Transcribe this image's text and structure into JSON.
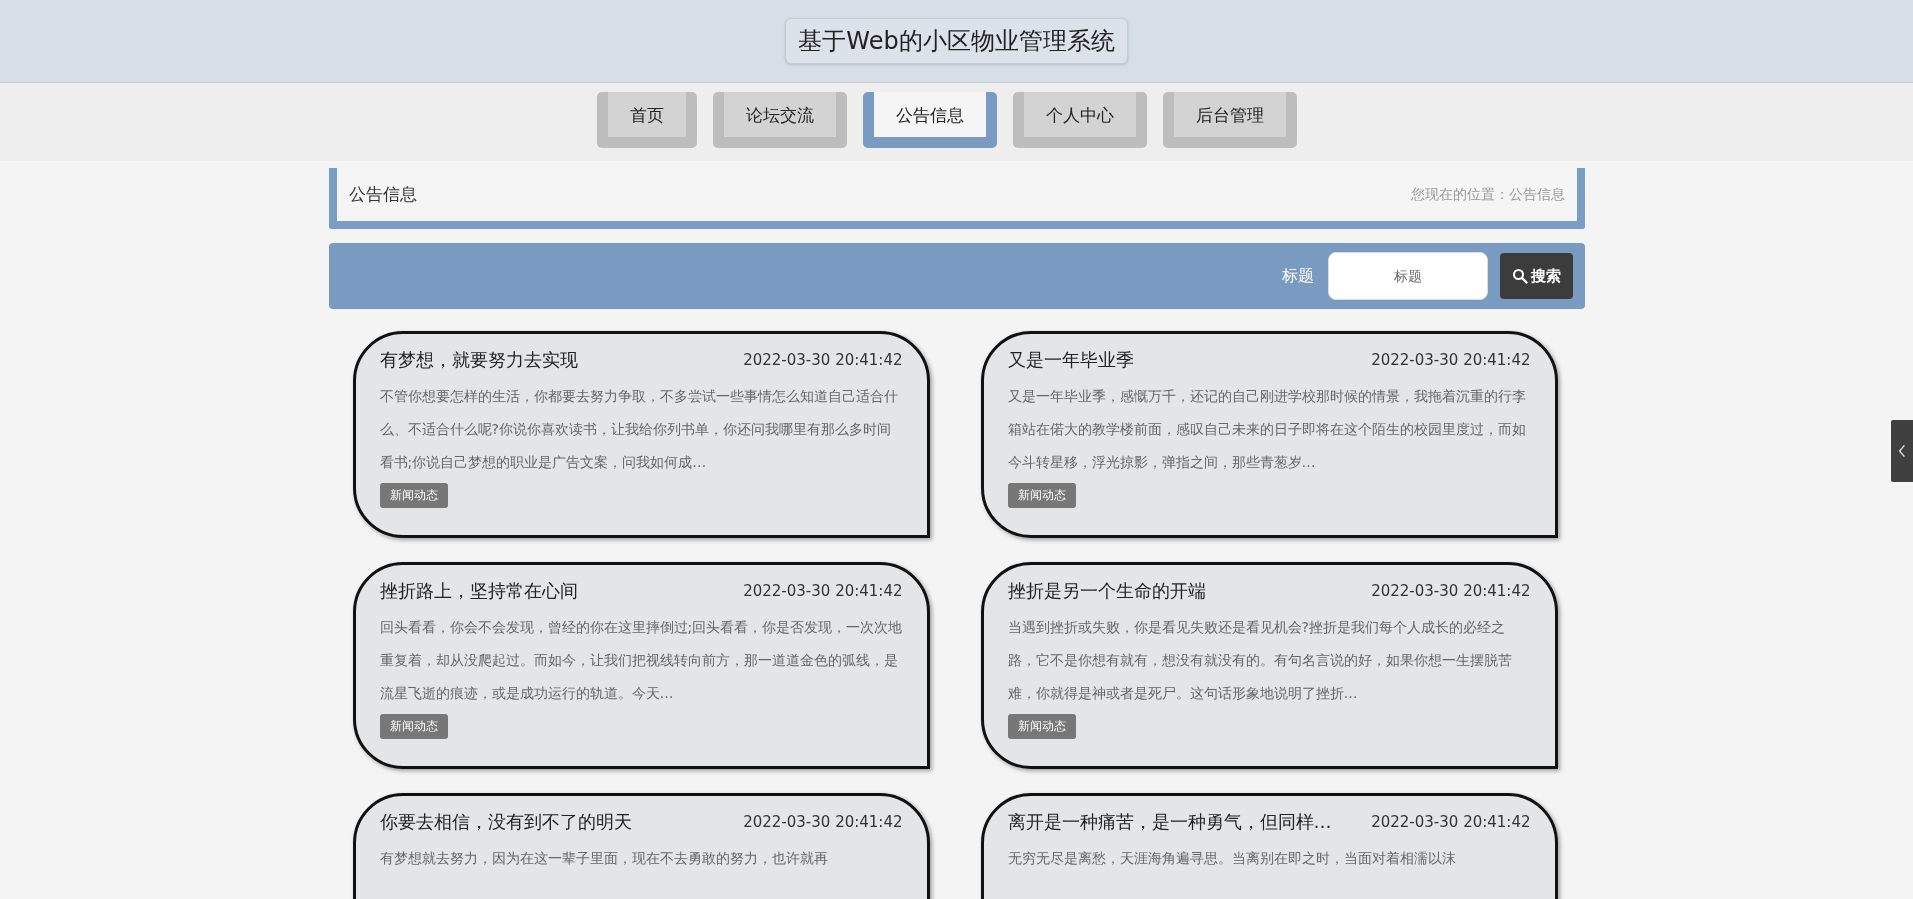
{
  "header": {
    "title": "基于Web的小区物业管理系统"
  },
  "nav": [
    {
      "label": "首页",
      "selected": false
    },
    {
      "label": "论坛交流",
      "selected": false
    },
    {
      "label": "公告信息",
      "selected": true
    },
    {
      "label": "个人中心",
      "selected": false
    },
    {
      "label": "后台管理",
      "selected": false
    }
  ],
  "breadcrumb": {
    "heading": "公告信息",
    "location": "您现在的位置：公告信息"
  },
  "search": {
    "label": "标题",
    "placeholder": "标题",
    "button": "搜索"
  },
  "notices": [
    {
      "title": "有梦想，就要努力去实现",
      "date": "2022-03-30 20:41:42",
      "summary": "不管你想要怎样的生活，你都要去努力争取，不多尝试一些事情怎么知道自己适合什么、不适合什么呢?你说你喜欢读书，让我给你列书单，你还问我哪里有那么多时间看书;你说自己梦想的职业是广告文案，问我如何成…",
      "tag": "新闻动态"
    },
    {
      "title": "又是一年毕业季",
      "date": "2022-03-30 20:41:42",
      "summary": "又是一年毕业季，感慨万千，还记的自己刚进学校那时候的情景，我拖着沉重的行李箱站在偌大的教学楼前面，感叹自己未来的日子即将在这个陌生的校园里度过，而如今斗转星移，浮光掠影，弹指之间，那些青葱岁…",
      "tag": "新闻动态"
    },
    {
      "title": "挫折路上，坚持常在心间",
      "date": "2022-03-30 20:41:42",
      "summary": "回头看看，你会不会发现，曾经的你在这里摔倒过;回头看看，你是否发现，一次次地重复着，却从没爬起过。而如今，让我们把视线转向前方，那一道道金色的弧线，是流星飞逝的痕迹，或是成功运行的轨道。今天…",
      "tag": "新闻动态"
    },
    {
      "title": "挫折是另一个生命的开端",
      "date": "2022-03-30 20:41:42",
      "summary": "当遇到挫折或失败，你是看见失败还是看见机会?挫折是我们每个人成长的必经之路，它不是你想有就有，想没有就没有的。有句名言说的好，如果你想一生摆脱苦难，你就得是神或者是死尸。这句话形象地说明了挫折…",
      "tag": "新闻动态"
    },
    {
      "title": "你要去相信，没有到不了的明天",
      "date": "2022-03-30 20:41:42",
      "summary": "有梦想就去努力，因为在这一辈子里面，现在不去勇敢的努力，也许就再"
    },
    {
      "title": "离开是一种痛苦，是一种勇气，但同样…",
      "date": "2022-03-30 20:41:42",
      "summary": "无穷无尽是离愁，天涯海角遍寻思。当离别在即之时，当面对着相濡以沫"
    }
  ]
}
